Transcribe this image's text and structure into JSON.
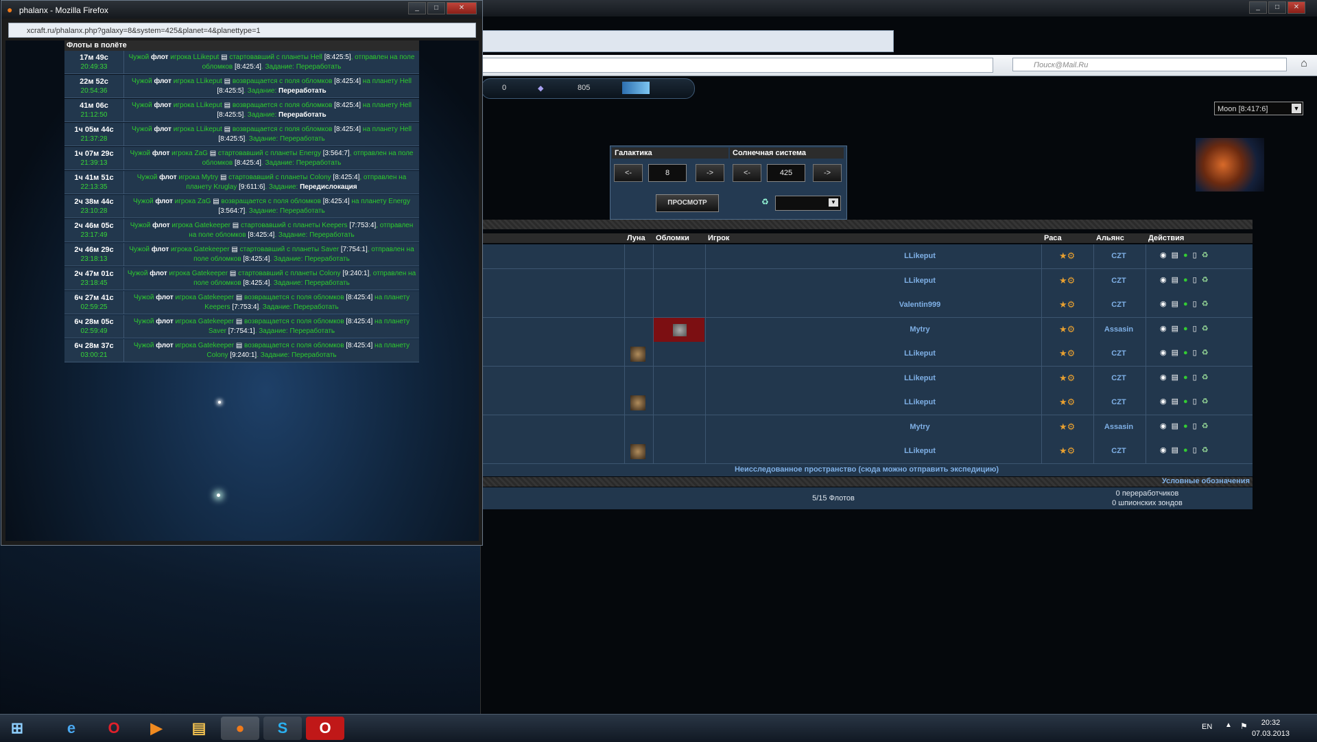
{
  "popup": {
    "title": "phalanx - Mozilla Firefox",
    "url": "xcraft.ru/phalanx.php?galaxy=8&system=425&planet=4&planettype=1",
    "table_title": "Флоты в полёте",
    "rows": [
      {
        "t1": "17м 49с",
        "t2": "20:49:33",
        "a": "Чужой ",
        "b": "флот",
        "c": " игрока LLikeput ",
        "d": " стартовавший с планеты Hell ",
        "e": "[8:425:5]",
        "f": ", отправлен на поле обломков ",
        "g": "[8:425:4]",
        "h": ". Задание: ",
        "i": "Переработать",
        "bold_task": false
      },
      {
        "t1": "22м 52с",
        "t2": "20:54:36",
        "a": "Чужой ",
        "b": "флот",
        "c": " игрока LLikeput ",
        "d": " возвращается с поля обломков ",
        "e": "[8:425:4]",
        "f": " на планету Hell ",
        "g": "[8:425:5]",
        "h": ". Задание: ",
        "i": "Переработать",
        "bold_task": true
      },
      {
        "t1": "41м 06с",
        "t2": "21:12:50",
        "a": "Чужой ",
        "b": "флот",
        "c": " игрока LLikeput ",
        "d": " возвращается с поля обломков ",
        "e": "[8:425:4]",
        "f": " на планету Hell ",
        "g": "[8:425:5]",
        "h": ". Задание: ",
        "i": "Переработать",
        "bold_task": true
      },
      {
        "t1": "1ч 05м 44с",
        "t2": "21:37:28",
        "a": "Чужой ",
        "b": "флот",
        "c": " игрока LLikeput ",
        "d": " возвращается с поля обломков ",
        "e": "[8:425:4]",
        "f": " на планету Hell ",
        "g": "[8:425:5]",
        "h": ". Задание: ",
        "i": "Переработать",
        "bold_task": false
      },
      {
        "t1": "1ч 07м 29с",
        "t2": "21:39:13",
        "a": "Чужой ",
        "b": "флот",
        "c": " игрока ZaG ",
        "d": " стартовавший с планеты Energy ",
        "e": "[3:564:7]",
        "f": ", отправлен на поле обломков ",
        "g": "[8:425:4]",
        "h": ". Задание: ",
        "i": "Переработать",
        "bold_task": false
      },
      {
        "t1": "1ч 41м 51с",
        "t2": "22:13:35",
        "a": "Чужой ",
        "b": "флот",
        "c": " игрока Mytry ",
        "d": " стартовавший с планеты Colony ",
        "e": "[8:425:4]",
        "f": ", отправлен на планету Kruglay ",
        "g": "[9:611:6]",
        "h": ". Задание: ",
        "i": "Передислокация",
        "bold_task": true
      },
      {
        "t1": "2ч 38м 44с",
        "t2": "23:10:28",
        "a": "Чужой ",
        "b": "флот",
        "c": " игрока ZaG ",
        "d": " возвращается с поля обломков ",
        "e": "[8:425:4]",
        "f": " на планету Energy ",
        "g": "[3:564:7]",
        "h": ". Задание: ",
        "i": "Переработать",
        "bold_task": false
      },
      {
        "t1": "2ч 46м 05с",
        "t2": "23:17:49",
        "a": "Чужой ",
        "b": "флот",
        "c": " игрока Gatekeeper ",
        "d": " стартовавший с планеты Keepers ",
        "e": "[7:753:4]",
        "f": ", отправлен на поле обломков ",
        "g": "[8:425:4]",
        "h": ". Задание: ",
        "i": "Переработать",
        "bold_task": false
      },
      {
        "t1": "2ч 46м 29с",
        "t2": "23:18:13",
        "a": "Чужой ",
        "b": "флот",
        "c": " игрока Gatekeeper ",
        "d": " стартовавший с планеты Saver ",
        "e": "[7:754:1]",
        "f": ", отправлен на поле обломков ",
        "g": "[8:425:4]",
        "h": ". Задание: ",
        "i": "Переработать",
        "bold_task": false
      },
      {
        "t1": "2ч 47м 01с",
        "t2": "23:18:45",
        "a": "Чужой ",
        "b": "флот",
        "c": " игрока Gatekeeper ",
        "d": " стартовавший с планеты Colony ",
        "e": "[9:240:1]",
        "f": ", отправлен на поле обломков ",
        "g": "[8:425:4]",
        "h": ". Задание: ",
        "i": "Переработать",
        "bold_task": false
      },
      {
        "t1": "6ч 27м 41с",
        "t2": "02:59:25",
        "a": "Чужой ",
        "b": "флот",
        "c": " игрока Gatekeeper ",
        "d": " возвращается с поля обломков ",
        "e": "[8:425:4]",
        "f": " на планету Keepers ",
        "g": "[7:753:4]",
        "h": ". Задание: ",
        "i": "Переработать",
        "bold_task": false
      },
      {
        "t1": "6ч 28м 05с",
        "t2": "02:59:49",
        "a": "Чужой ",
        "b": "флот",
        "c": " игрока Gatekeeper ",
        "d": " возвращается с поля обломков ",
        "e": "[8:425:4]",
        "f": " на планету Saver ",
        "g": "[7:754:1]",
        "h": ". Задание: ",
        "i": "Переработать",
        "bold_task": false
      },
      {
        "t1": "6ч 28м 37с",
        "t2": "03:00:21",
        "a": "Чужой ",
        "b": "флот",
        "c": " игрока Gatekeeper ",
        "d": " возвращается с поля обломков ",
        "e": "[8:425:4]",
        "f": " на планету Colony ",
        "g": "[9:240:1]",
        "h": ". Задание: ",
        "i": "Переработать",
        "bold_task": false
      }
    ]
  },
  "browser": {
    "search_placeholder": "Поиск@Mail.Ru",
    "resources": {
      "r1": "0",
      "r2": "805"
    },
    "moon_select": "Moon [8:417:6]",
    "galaxy": {
      "label": "Галактика",
      "value": "8",
      "system_label": "Солнечная система",
      "system_value": "425",
      "prev": "<-",
      "next": "->",
      "view_button": "ПРОСМОТР"
    },
    "table": {
      "headers": {
        "moon": "Луна",
        "debris": "Обломки",
        "player": "Игрок",
        "race": "Раса",
        "alliance": "Альянс",
        "actions": "Действия"
      },
      "rows": [
        {
          "player": "LLikeput",
          "alliance": "CZT",
          "moon": false,
          "debris": false
        },
        {
          "player": "LLikeput",
          "alliance": "CZT",
          "moon": false,
          "debris": false
        },
        {
          "player": "Valentin999",
          "alliance": "CZT",
          "moon": false,
          "debris": false
        },
        {
          "player": "Mytry",
          "alliance": "Assasin",
          "moon": false,
          "debris": true
        },
        {
          "player": "LLikeput",
          "alliance": "CZT",
          "moon": true,
          "debris": false
        },
        {
          "player": "LLikeput",
          "alliance": "CZT",
          "moon": false,
          "debris": false
        },
        {
          "player": "LLikeput",
          "alliance": "CZT",
          "moon": true,
          "debris": false
        },
        {
          "player": "Mytry",
          "alliance": "Assasin",
          "moon": false,
          "debris": false
        },
        {
          "player": "LLikeput",
          "alliance": "CZT",
          "moon": true,
          "debris": false
        }
      ],
      "unexplored": "Неисследованное пространство (сюда можно отправить экспедицию)",
      "legend": "Условные обозначения",
      "fleets": "5/15 Флотов",
      "recyclers": "0 переработчиков",
      "probes": "0 шпионских зондов"
    }
  },
  "taskbar": {
    "lang": "EN",
    "time": "20:32",
    "date": "07.03.2013"
  }
}
